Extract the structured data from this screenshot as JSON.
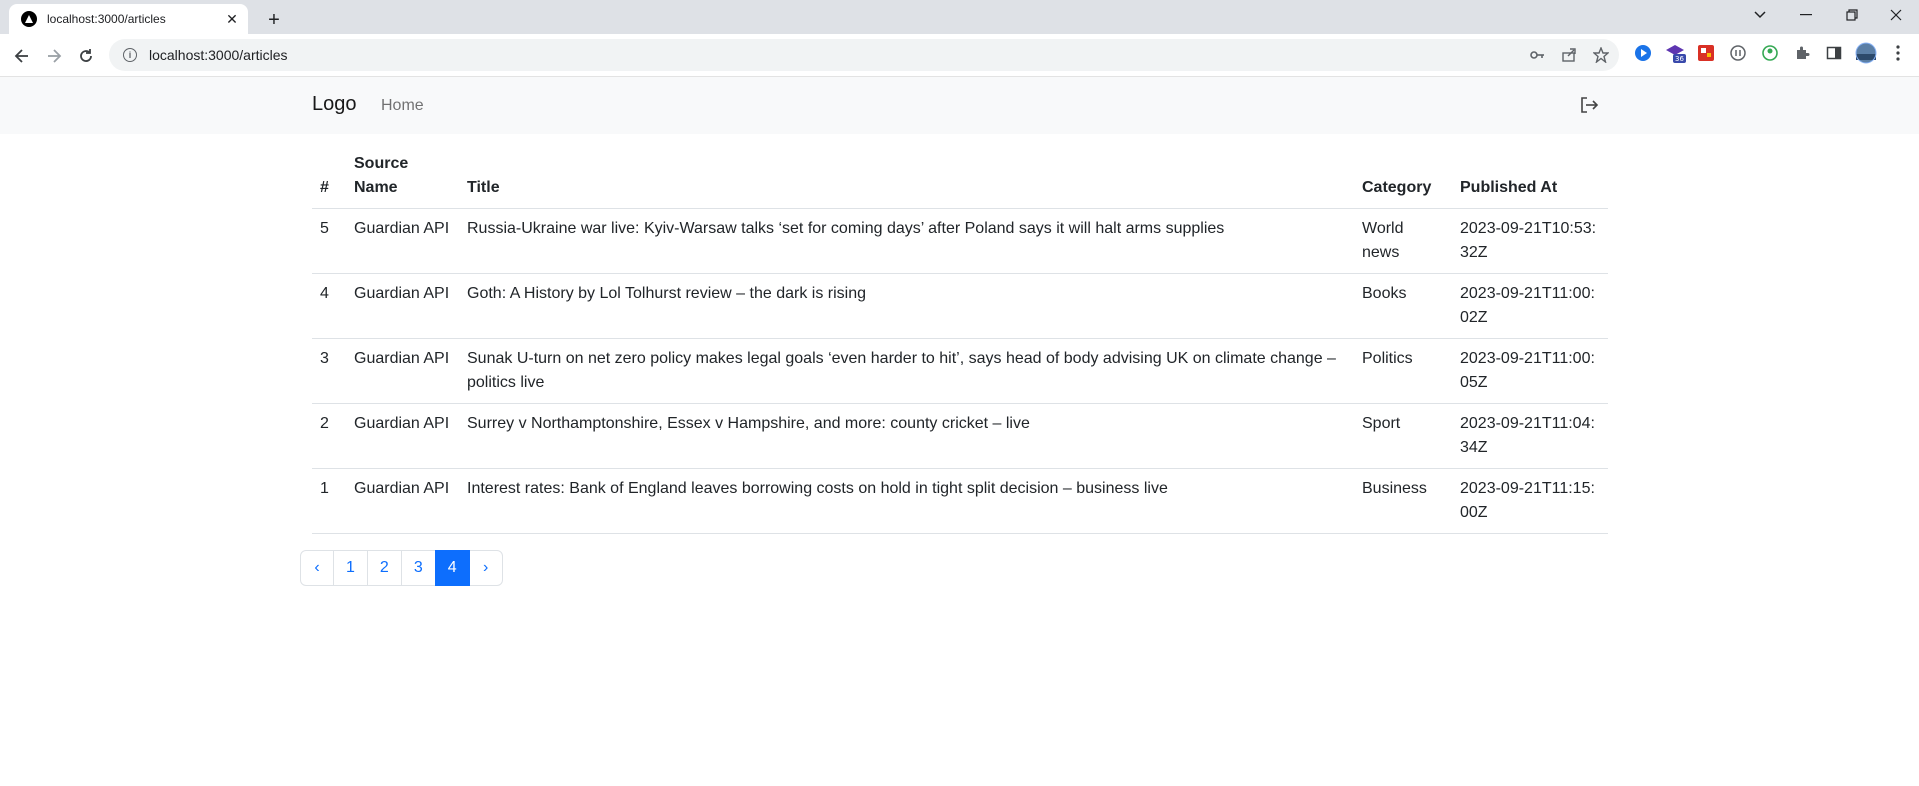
{
  "browser": {
    "tab_title": "localhost:3000/articles",
    "url": "localhost:3000/articles",
    "extension_badge": "36"
  },
  "navbar": {
    "brand": "Logo",
    "home": "Home",
    "logout_icon": "logout-icon"
  },
  "table": {
    "headers": {
      "num": "#",
      "source_line1": "Source",
      "source_line2": "Name",
      "title": "Title",
      "category": "Category",
      "published": "Published At"
    },
    "rows": [
      {
        "num": "5",
        "source": "Guardian API",
        "title": "Russia-Ukraine war live: Kyiv-Warsaw talks ‘set for coming days’ after Poland says it will halt arms supplies",
        "category": "World news",
        "published": "2023-09-21T10:53:32Z"
      },
      {
        "num": "4",
        "source": "Guardian API",
        "title": "Goth: A History by Lol Tolhurst review – the dark is rising",
        "category": "Books",
        "published": "2023-09-21T11:00:02Z"
      },
      {
        "num": "3",
        "source": "Guardian API",
        "title": "Sunak U-turn on net zero policy makes legal goals ‘even harder to hit’, says head of body advising UK on climate change – politics live",
        "category": "Politics",
        "published": "2023-09-21T11:00:05Z"
      },
      {
        "num": "2",
        "source": "Guardian API",
        "title": "Surrey v Northamptonshire, Essex v Hampshire, and more: county cricket – live",
        "category": "Sport",
        "published": "2023-09-21T11:04:34Z"
      },
      {
        "num": "1",
        "source": "Guardian API",
        "title": "Interest rates: Bank of England leaves borrowing costs on hold in tight split decision – business live",
        "category": "Business",
        "published": "2023-09-21T11:15:00Z"
      }
    ]
  },
  "pagination": {
    "prev": "‹",
    "pages": [
      "1",
      "2",
      "3",
      "4"
    ],
    "active": "4",
    "next": "›"
  },
  "colors": {
    "accent": "#0d6efd",
    "navbar_bg": "#f8f9fa",
    "tabstrip_bg": "#dee1e6"
  }
}
